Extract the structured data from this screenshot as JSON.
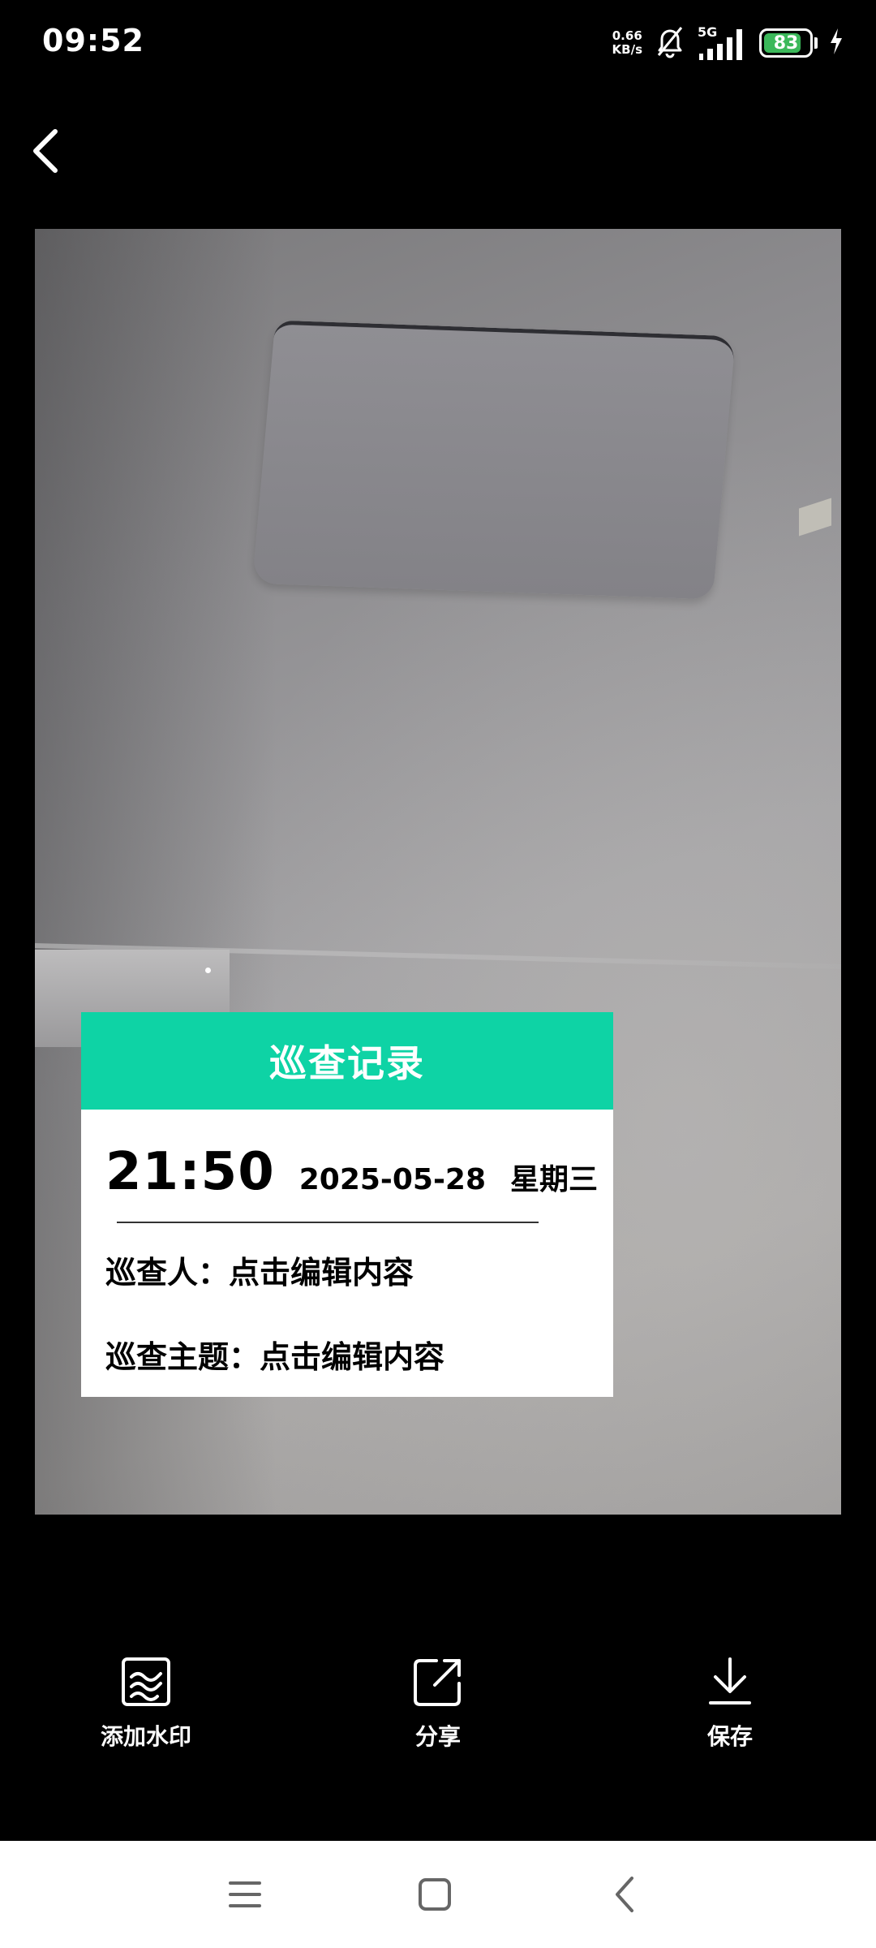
{
  "status_bar": {
    "time": "09:52",
    "net_speed_value": "0.66",
    "net_speed_unit": "KB/s",
    "network_type": "5G",
    "battery_level": "83",
    "battery_fraction": 0.83,
    "icons": [
      "mute-bell-icon",
      "signal-icon",
      "battery-icon",
      "charging-icon"
    ]
  },
  "header": {
    "back_icon": "chevron-left-icon"
  },
  "watermark": {
    "title": "巡查记录",
    "time": "21:50",
    "date": "2025-05-28",
    "weekday": "星期三",
    "inspector_label": "巡查人：",
    "inspector_value": "点击编辑内容",
    "topic_label": "巡查主题：",
    "topic_value": "点击编辑内容",
    "accent_color": "#0ed3a5"
  },
  "actions": [
    {
      "label": "添加水印",
      "icon": "watermark-icon"
    },
    {
      "label": "分享",
      "icon": "share-icon"
    },
    {
      "label": "保存",
      "icon": "download-icon"
    }
  ],
  "nav_bar": {
    "icons": [
      "menu-icon",
      "home-icon",
      "back-icon"
    ]
  }
}
